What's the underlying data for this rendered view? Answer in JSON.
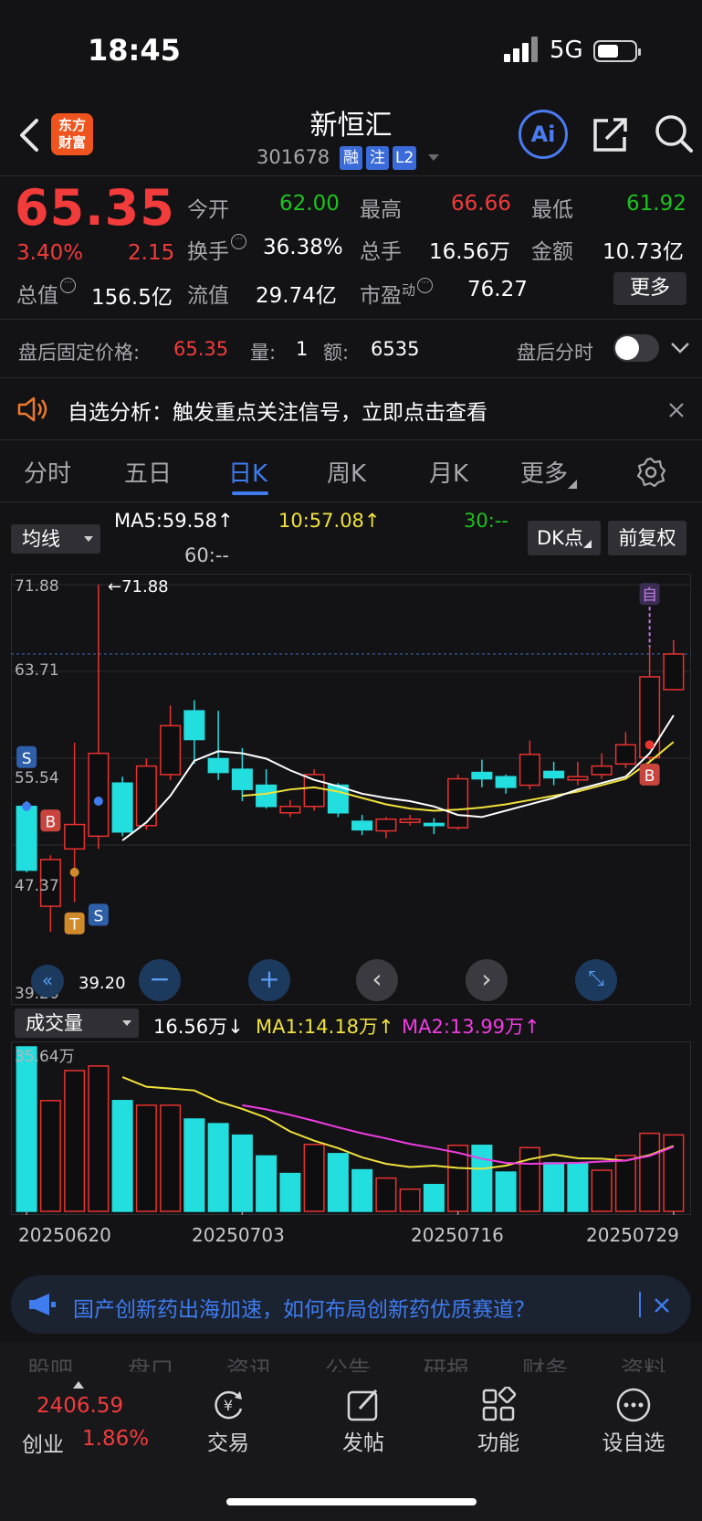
{
  "status": {
    "time": "18:45",
    "network": "5G"
  },
  "header": {
    "name": "新恒汇",
    "code": "301678",
    "tags": [
      "融",
      "注",
      "L2"
    ],
    "logo": [
      "东方",
      "财富"
    ],
    "ai_label": "Ai"
  },
  "quote": {
    "price": "65.35",
    "change_pct": "3.40%",
    "change": "2.15",
    "open_label": "今开",
    "open": "62.00",
    "high_label": "最高",
    "high": "66.66",
    "low_label": "最低",
    "low": "61.92",
    "turnover_label": "换手",
    "turnover": "36.38%",
    "volume_label": "总手",
    "volume": "16.56万",
    "amount_label": "金额",
    "amount": "10.73亿",
    "mcap_label": "总值",
    "mcap": "156.5亿",
    "float_label": "流值",
    "float": "29.74亿",
    "pe_label": "市盈",
    "pe_super": "动",
    "pe": "76.27",
    "more": "更多"
  },
  "after_hours": {
    "price_label": "盘后固定价格:",
    "price": "65.35",
    "vol_label": "量:",
    "vol": "1",
    "amt_label": "额:",
    "amt": "6535",
    "timeshare_label": "盘后分时"
  },
  "analysis": {
    "text": "自选分析：触发重点关注信号，立即点击查看"
  },
  "tabs": [
    "分时",
    "五日",
    "日K",
    "周K",
    "月K",
    "更多"
  ],
  "active_tab": "日K",
  "kline": {
    "indicator": "均线",
    "ma5": "MA5:59.58↑",
    "ma10": "10:57.08↑",
    "ma30": "30:--",
    "ma60": "60:--",
    "dk_label": "DK点",
    "adjust_label": "前复权",
    "axis": [
      "71.88",
      "63.71",
      "55.54",
      "47.37",
      "39.20"
    ],
    "max_label": "←71.88",
    "min_label": "39.20",
    "markers": {
      "s": "S",
      "b": "B",
      "t": "T",
      "zi": "自"
    }
  },
  "volume": {
    "indicator": "成交量",
    "vol": "16.56万↓",
    "ma1": "MA1:14.18万↑",
    "ma2": "MA2:13.99万↑",
    "axis_max": "35.64万"
  },
  "dates": [
    "20250620",
    "20250703",
    "20250716",
    "20250729"
  ],
  "chart_data": {
    "type": "candlestick",
    "ylim": [
      39.2,
      71.88
    ],
    "candles": [
      {
        "o": 45.0,
        "c": 51.0,
        "h": 51.5,
        "l": 44.8,
        "up": false
      },
      {
        "o": 41.6,
        "c": 46.0,
        "h": 46.4,
        "l": 39.2,
        "up": true
      },
      {
        "o": 47.0,
        "c": 49.3,
        "h": 57.0,
        "l": 42.0,
        "up": true
      },
      {
        "o": 48.2,
        "c": 56.0,
        "h": 71.88,
        "l": 47.0,
        "up": true
      },
      {
        "o": 53.2,
        "c": 48.6,
        "h": 53.8,
        "l": 48.2,
        "up": false
      },
      {
        "o": 49.2,
        "c": 54.8,
        "h": 55.5,
        "l": 48.8,
        "up": true
      },
      {
        "o": 54.0,
        "c": 58.6,
        "h": 60.5,
        "l": 53.5,
        "up": true
      },
      {
        "o": 60.0,
        "c": 57.3,
        "h": 61.0,
        "l": 55.0,
        "up": false
      },
      {
        "o": 55.5,
        "c": 54.2,
        "h": 60.0,
        "l": 53.5,
        "up": false
      },
      {
        "o": 54.5,
        "c": 52.6,
        "h": 56.5,
        "l": 51.5,
        "up": false
      },
      {
        "o": 53.0,
        "c": 51.0,
        "h": 54.5,
        "l": 50.8,
        "up": false
      },
      {
        "o": 50.4,
        "c": 51.0,
        "h": 51.6,
        "l": 50.0,
        "up": true
      },
      {
        "o": 51.0,
        "c": 54.0,
        "h": 54.5,
        "l": 50.6,
        "up": true
      },
      {
        "o": 53.0,
        "c": 50.4,
        "h": 53.2,
        "l": 50.0,
        "up": false
      },
      {
        "o": 49.6,
        "c": 48.8,
        "h": 50.2,
        "l": 48.3,
        "up": false
      },
      {
        "o": 48.7,
        "c": 49.8,
        "h": 50.0,
        "l": 48.0,
        "up": true
      },
      {
        "o": 49.5,
        "c": 49.8,
        "h": 50.2,
        "l": 49.2,
        "up": true
      },
      {
        "o": 49.4,
        "c": 49.2,
        "h": 49.9,
        "l": 48.4,
        "up": false
      },
      {
        "o": 49.0,
        "c": 53.6,
        "h": 54.0,
        "l": 48.8,
        "up": true
      },
      {
        "o": 54.2,
        "c": 53.6,
        "h": 55.4,
        "l": 52.8,
        "up": false
      },
      {
        "o": 53.8,
        "c": 52.8,
        "h": 54.0,
        "l": 52.2,
        "up": false
      },
      {
        "o": 53.0,
        "c": 55.9,
        "h": 57.2,
        "l": 52.6,
        "up": true
      },
      {
        "o": 54.3,
        "c": 53.7,
        "h": 55.2,
        "l": 53.0,
        "up": false
      },
      {
        "o": 53.5,
        "c": 53.8,
        "h": 55.2,
        "l": 53.0,
        "up": true
      },
      {
        "o": 54.0,
        "c": 54.8,
        "h": 56.0,
        "l": 53.6,
        "up": true
      },
      {
        "o": 55.0,
        "c": 56.8,
        "h": 58.0,
        "l": 54.6,
        "up": true
      },
      {
        "o": 55.6,
        "c": 63.2,
        "h": 66.0,
        "l": 55.2,
        "up": true
      },
      {
        "o": 62.0,
        "c": 65.35,
        "h": 66.66,
        "l": 61.92,
        "up": true
      }
    ],
    "ma5": [
      null,
      null,
      null,
      null,
      47.8,
      49.5,
      52.0,
      55.3,
      56.2,
      56.0,
      55.5,
      54.4,
      53.5,
      52.9,
      52.2,
      51.8,
      51.5,
      51.0,
      50.2,
      50.0,
      50.6,
      51.2,
      51.8,
      52.6,
      53.2,
      53.8,
      56.0,
      59.58
    ],
    "ma10": [
      null,
      null,
      null,
      null,
      null,
      null,
      null,
      null,
      null,
      52.0,
      52.2,
      52.6,
      52.8,
      52.4,
      51.8,
      51.2,
      50.8,
      50.6,
      50.7,
      50.9,
      51.2,
      51.6,
      52.0,
      52.4,
      53.0,
      53.6,
      55.2,
      57.08
    ],
    "volume_ylim": [
      0,
      35.64
    ],
    "volume": [
      {
        "v": 35.64,
        "up": false
      },
      {
        "v": 24.0,
        "up": true
      },
      {
        "v": 30.5,
        "up": true
      },
      {
        "v": 31.5,
        "up": true
      },
      {
        "v": 24.0,
        "up": false
      },
      {
        "v": 23.0,
        "up": true
      },
      {
        "v": 23.0,
        "up": true
      },
      {
        "v": 20.0,
        "up": false
      },
      {
        "v": 19.0,
        "up": false
      },
      {
        "v": 16.5,
        "up": false
      },
      {
        "v": 12.0,
        "up": false
      },
      {
        "v": 8.2,
        "up": false
      },
      {
        "v": 14.5,
        "up": true
      },
      {
        "v": 12.5,
        "up": false
      },
      {
        "v": 9.0,
        "up": false
      },
      {
        "v": 7.2,
        "up": true
      },
      {
        "v": 4.8,
        "up": true
      },
      {
        "v": 5.8,
        "up": false
      },
      {
        "v": 14.3,
        "up": true
      },
      {
        "v": 14.3,
        "up": false
      },
      {
        "v": 8.5,
        "up": false
      },
      {
        "v": 13.8,
        "up": true
      },
      {
        "v": 10.5,
        "up": false
      },
      {
        "v": 10.5,
        "up": false
      },
      {
        "v": 8.9,
        "up": true
      },
      {
        "v": 12.1,
        "up": true
      },
      {
        "v": 16.9,
        "up": true
      },
      {
        "v": 16.56,
        "up": true
      }
    ],
    "vma1": [
      null,
      null,
      null,
      null,
      29.1,
      27.0,
      26.6,
      26.2,
      23.8,
      22.2,
      20.3,
      17.3,
      15.3,
      13.7,
      11.7,
      10.3,
      9.6,
      9.9,
      9.4,
      9.2,
      9.9,
      11.3,
      12.3,
      11.5,
      11.4,
      11.0,
      12.2,
      14.18
    ],
    "vma2": [
      null,
      null,
      null,
      null,
      null,
      null,
      null,
      null,
      null,
      23.0,
      22.1,
      20.9,
      19.6,
      18.2,
      16.9,
      15.8,
      14.6,
      13.7,
      12.7,
      11.4,
      10.5,
      10.3,
      10.4,
      10.5,
      10.8,
      11.0,
      12.0,
      13.99
    ],
    "colors": {
      "up": "#e8322f",
      "down": "#22dede",
      "ma5": "#ffffff",
      "ma10": "#f0e23a",
      "vma1": "#f0e23a",
      "vma2": "#f03ce0"
    }
  },
  "news": {
    "text": "国产创新药出海加速，如何布局创新药优质赛道？"
  },
  "bottom_nav": {
    "index_value": "2406.59",
    "index_name": "创业",
    "index_pct": "1.86%",
    "items": [
      "交易",
      "发帖",
      "功能",
      "设自选"
    ],
    "ghost_tabs": [
      "股吧",
      "盘口",
      "资讯",
      "公告",
      "研报",
      "财务",
      "资料"
    ]
  }
}
